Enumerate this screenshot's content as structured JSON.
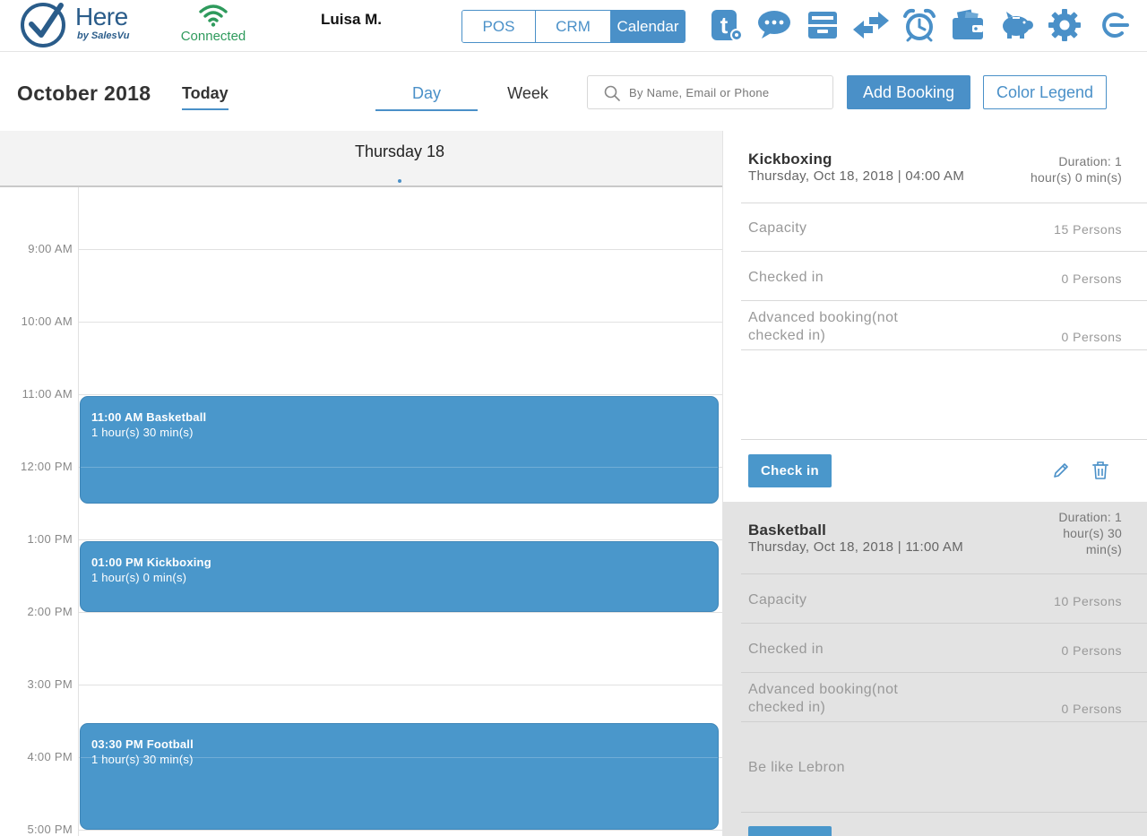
{
  "header": {
    "logo_here": "Here",
    "logo_by": "by SalesVu",
    "connection_status": "Connected",
    "user_name": "Luisa M.",
    "segments": [
      {
        "label": "POS",
        "active": false
      },
      {
        "label": "CRM",
        "active": false
      },
      {
        "label": "Calendar",
        "active": true
      }
    ],
    "icons": [
      "timesheet-icon",
      "chat-icon",
      "inbox-icon",
      "transfer-icon",
      "alarm-clock-icon",
      "wallet-icon",
      "piggy-bank-icon",
      "gear-icon",
      "logout-icon"
    ],
    "accent_color": "#4a90c8",
    "connected_color": "#2e9a5c"
  },
  "toolbar": {
    "month": "October 2018",
    "today": "Today",
    "day_tab": "Day",
    "week_tab": "Week",
    "search_placeholder": "By Name, Email or Phone",
    "add_booking": "Add Booking",
    "color_legend": "Color Legend"
  },
  "calendar": {
    "day_title": "Thursday 18",
    "hours": [
      "9:00 AM",
      "10:00 AM",
      "11:00 AM",
      "12:00 PM",
      "1:00 PM",
      "2:00 PM",
      "3:00 PM",
      "4:00 PM",
      "5:00 PM"
    ],
    "events": [
      {
        "title": "11:00 AM Basketball",
        "duration": "1 hour(s) 30 min(s)",
        "start_hour": 11.0,
        "length_hours": 1.5
      },
      {
        "title": "01:00 PM Kickboxing",
        "duration": "1 hour(s) 0 min(s)",
        "start_hour": 13.0,
        "length_hours": 1.0
      },
      {
        "title": "03:30 PM Football",
        "duration": "1 hour(s) 30 min(s)",
        "start_hour": 15.5,
        "length_hours": 1.5
      }
    ],
    "event_color": "#4a97cb"
  },
  "details": {
    "selected": {
      "title": "Kickboxing",
      "date": "Thursday, Oct 18, 2018 | 04:00 AM",
      "duration_line1": "Duration: 1",
      "duration_line2": "hour(s) 0 min(s)",
      "rows": [
        {
          "label": "Capacity",
          "value": "15 Persons"
        },
        {
          "label": "Checked in",
          "value": "0 Persons"
        },
        {
          "label": "Advanced booking(not checked in)",
          "value": "0 Persons"
        }
      ],
      "checkin": "Check in"
    },
    "other": {
      "title": "Basketball",
      "date": "Thursday, Oct 18, 2018 | 11:00 AM",
      "duration_line1": "Duration: 1",
      "duration_line2": "hour(s) 30",
      "duration_line3": "min(s)",
      "rows": [
        {
          "label": "Capacity",
          "value": "10 Persons"
        },
        {
          "label": "Checked in",
          "value": "0 Persons"
        },
        {
          "label": "Advanced booking(not checked in)",
          "value": "0 Persons"
        }
      ],
      "note": "Be like Lebron"
    }
  }
}
